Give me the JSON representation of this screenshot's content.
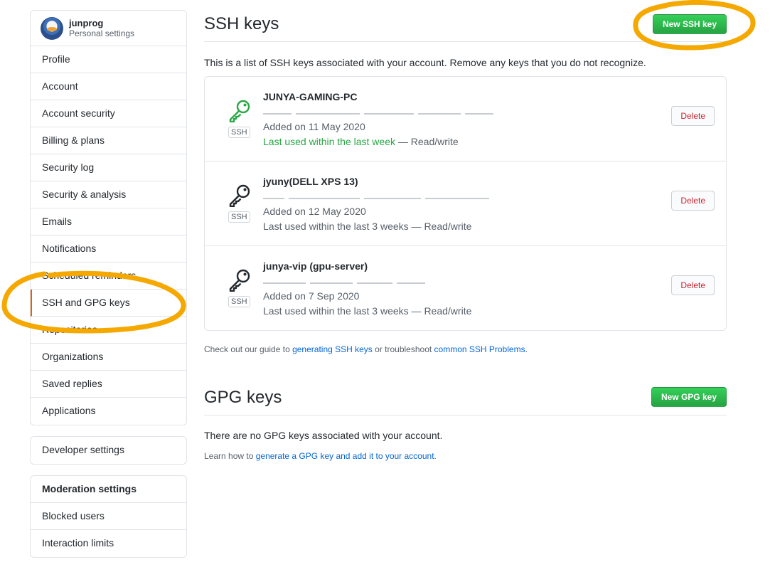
{
  "user": {
    "login": "junprog",
    "subtitle": "Personal settings"
  },
  "sidebar": {
    "items": [
      {
        "label": "Profile"
      },
      {
        "label": "Account"
      },
      {
        "label": "Account security"
      },
      {
        "label": "Billing & plans"
      },
      {
        "label": "Security log"
      },
      {
        "label": "Security & analysis"
      },
      {
        "label": "Emails"
      },
      {
        "label": "Notifications"
      },
      {
        "label": "Scheduled reminders"
      },
      {
        "label": "SSH and GPG keys",
        "selected": true
      },
      {
        "label": "Repositories"
      },
      {
        "label": "Organizations"
      },
      {
        "label": "Saved replies"
      },
      {
        "label": "Applications"
      }
    ],
    "developer": {
      "label": "Developer settings"
    },
    "moderation": {
      "heading": "Moderation settings",
      "items": [
        {
          "label": "Blocked users"
        },
        {
          "label": "Interaction limits"
        }
      ]
    }
  },
  "ssh": {
    "title": "SSH keys",
    "new_button": "New SSH key",
    "intro": "This is a list of SSH keys associated with your account. Remove any keys that you do not recognize.",
    "badge": "SSH",
    "delete_label": "Delete",
    "keys": [
      {
        "title": "JUNYA-GAMING-PC",
        "added": "Added on 11 May 2020",
        "used_recent": "Last used within the last week",
        "used_suffix": " — Read/write",
        "icon": "key-icon-green"
      },
      {
        "title": "jyuny(DELL XPS 13)",
        "added": "Added on 12 May 2020",
        "used_recent": "",
        "used_suffix": "Last used within the last 3 weeks — Read/write",
        "icon": "key-icon"
      },
      {
        "title": "junya-vip (gpu-server)",
        "added": "Added on 7 Sep 2020",
        "used_recent": "",
        "used_suffix": "Last used within the last 3 weeks — Read/write",
        "icon": "key-icon"
      }
    ],
    "help": {
      "prefix": "Check out our guide to ",
      "link1": "generating SSH keys",
      "middle": " or troubleshoot ",
      "link2": "common SSH Problems",
      "suffix": "."
    }
  },
  "gpg": {
    "title": "GPG keys",
    "new_button": "New GPG key",
    "empty": "There are no GPG keys associated with your account.",
    "help": {
      "prefix": "Learn how to ",
      "link": "generate a GPG key and add it to your account",
      "suffix": "."
    }
  },
  "colors": {
    "highlight": "#f5a800",
    "primary": "#28a745",
    "danger": "#cb2431",
    "link": "#0366d6"
  }
}
